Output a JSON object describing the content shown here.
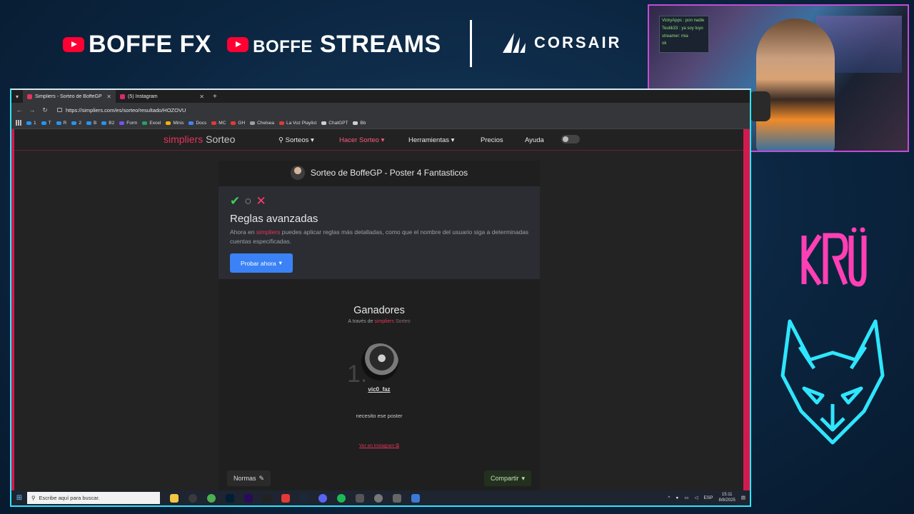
{
  "overlay": {
    "brand1": "BOFFE FX",
    "brand2_prefix": "BOFFE",
    "brand2_suffix": "STREAMS",
    "sponsor": "CORSAIR",
    "team_logo": "KRÜ",
    "colors": {
      "accent_cyan": "#2ee6ff",
      "kru_pink": "#ff3fb4",
      "youtube_red": "#ff0033"
    }
  },
  "webcam": {
    "chat_lines": [
      "VickyApps : pon nadie",
      "Teutik33 : ya soy tuyo",
      "streamer: mia",
      "ok"
    ]
  },
  "browser": {
    "tabs": [
      {
        "title": "Simpliers - Sorteo de BoffeGP",
        "favicon_color": "#e3355a",
        "active": true
      },
      {
        "title": "(5) Instagram",
        "favicon_color": "#d62976",
        "active": false
      }
    ],
    "new_tab": "+",
    "url": "https://simpliers.com/es/sorteo/resultado/HOZOVU",
    "bookmarks": [
      {
        "label": "1",
        "color": "#2196f3"
      },
      {
        "label": "T",
        "color": "#2196f3"
      },
      {
        "label": "R",
        "color": "#2196f3"
      },
      {
        "label": "2",
        "color": "#2196f3"
      },
      {
        "label": "B",
        "color": "#2196f3"
      },
      {
        "label": "B2",
        "color": "#2196f3"
      },
      {
        "label": "Form",
        "color": "#7c4dff"
      },
      {
        "label": "Excel",
        "color": "#21a366"
      },
      {
        "label": "Minis",
        "color": "#f4b400"
      },
      {
        "label": "Docs",
        "color": "#4285f4"
      },
      {
        "label": "MC",
        "color": "#e53935"
      },
      {
        "label": "GH",
        "color": "#e53935"
      },
      {
        "label": "Chelsea",
        "color": "#9e9e9e"
      },
      {
        "label": "La Voz Playlist",
        "color": "#e53935"
      },
      {
        "label": "ChatGPT",
        "color": "#cfcfcf"
      },
      {
        "label": "Bb",
        "color": "#cfcfcf"
      }
    ]
  },
  "site": {
    "logo_a": "simpliers",
    "logo_b": "Sorteo",
    "nav": {
      "sorteos": "Sorteos",
      "hacer_sorteo": "Hacer Sorteo",
      "herramientas": "Herramientas",
      "precios": "Precios",
      "ayuda": "Ayuda"
    },
    "giveaway_title": "Sorteo de BoffeGP - Poster 4 Fantasticos",
    "promo": {
      "title": "Reglas avanzadas",
      "text_before": "Ahora en",
      "text_brand": "simpliers",
      "text_after": "puedes aplicar reglas más detalladas, como que el nombre del usuario siga a determinadas cuentas especificadas.",
      "button": "Probar ahora"
    },
    "winners": {
      "title": "Ganadores",
      "sub_before": "A través de",
      "sub_brand": "simpliers",
      "sub_after": "Sorteo",
      "rank": "1.",
      "username": "vic0_faz",
      "comment": "necesito ese poster",
      "ig_link": "Ver en Instagram"
    },
    "footer": {
      "rules": "Normas",
      "share": "Compartir"
    }
  },
  "taskbar": {
    "search_placeholder": "Escribe aquí para buscar.",
    "lang": "ESP",
    "time": "15:11",
    "date": "8/8/2025"
  }
}
